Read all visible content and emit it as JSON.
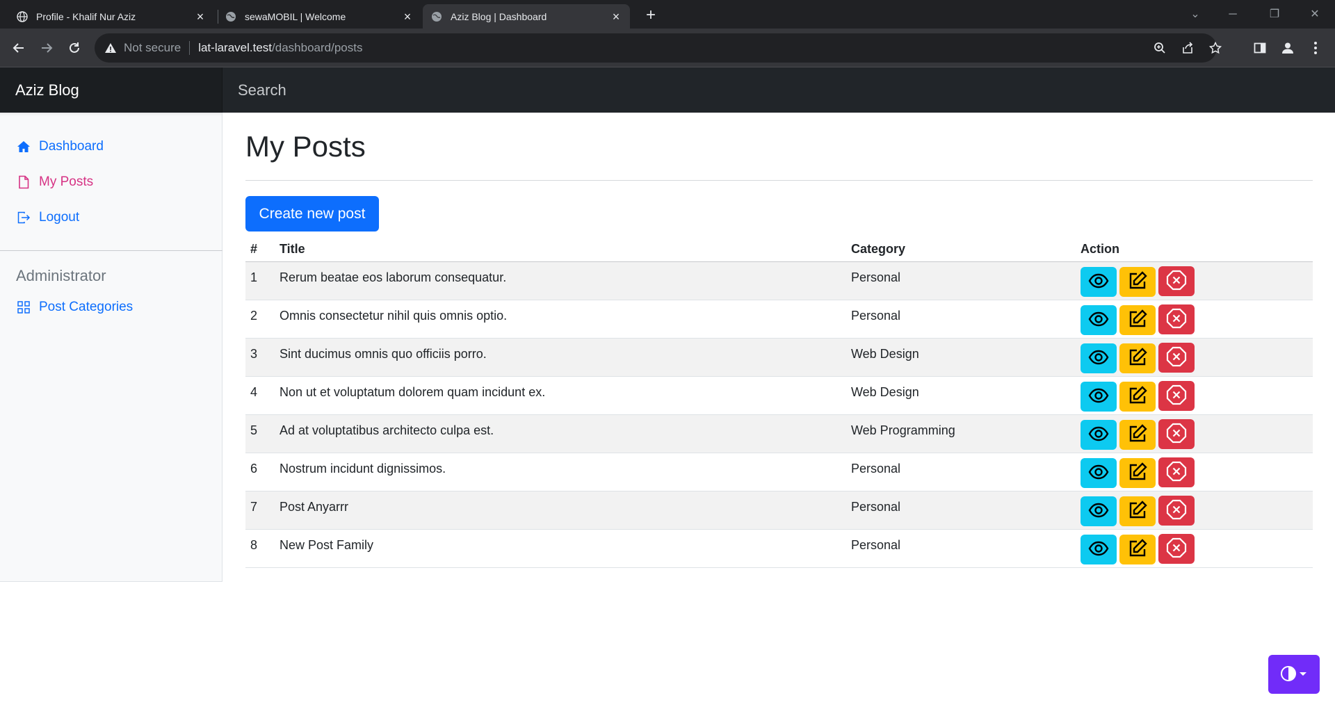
{
  "browser": {
    "tabs": [
      {
        "title": "Profile - Khalif Nur Aziz",
        "active": false
      },
      {
        "title": "sewaMOBIL | Welcome",
        "active": false
      },
      {
        "title": "Aziz Blog | Dashboard",
        "active": true
      }
    ],
    "security_label": "Not secure",
    "url_host": "lat-laravel.test",
    "url_path": "/dashboard/posts"
  },
  "navbar": {
    "brand": "Aziz Blog",
    "search_placeholder": "Search"
  },
  "sidebar": {
    "items": [
      {
        "label": "Dashboard",
        "icon": "home-icon",
        "active": false
      },
      {
        "label": "My Posts",
        "icon": "file-icon",
        "active": true
      },
      {
        "label": "Logout",
        "icon": "logout-icon",
        "active": false
      }
    ],
    "admin_heading": "Administrator",
    "admin_items": [
      {
        "label": "Post Categories",
        "icon": "grid-icon"
      }
    ]
  },
  "main": {
    "title": "My Posts",
    "create_button": "Create new post",
    "table": {
      "headers": [
        "#",
        "Title",
        "Category",
        "Action"
      ],
      "rows": [
        {
          "no": "1",
          "title": "Rerum beatae eos laborum consequatur.",
          "category": "Personal"
        },
        {
          "no": "2",
          "title": "Omnis consectetur nihil quis omnis optio.",
          "category": "Personal"
        },
        {
          "no": "3",
          "title": "Sint ducimus omnis quo officiis porro.",
          "category": "Web Design"
        },
        {
          "no": "4",
          "title": "Non ut et voluptatum dolorem quam incidunt ex.",
          "category": "Web Design"
        },
        {
          "no": "5",
          "title": "Ad at voluptatibus architecto culpa est.",
          "category": "Web Programming"
        },
        {
          "no": "6",
          "title": "Nostrum incidunt dignissimos.",
          "category": "Personal"
        },
        {
          "no": "7",
          "title": "Post Anyarrr",
          "category": "Personal"
        },
        {
          "no": "8",
          "title": "New Post Family",
          "category": "Personal"
        }
      ]
    }
  },
  "colors": {
    "primary": "#0d6efd",
    "active_link": "#d63384",
    "info": "#0dcaf0",
    "warning": "#ffc107",
    "danger": "#dc3545",
    "theme_toggle": "#712cf9"
  }
}
